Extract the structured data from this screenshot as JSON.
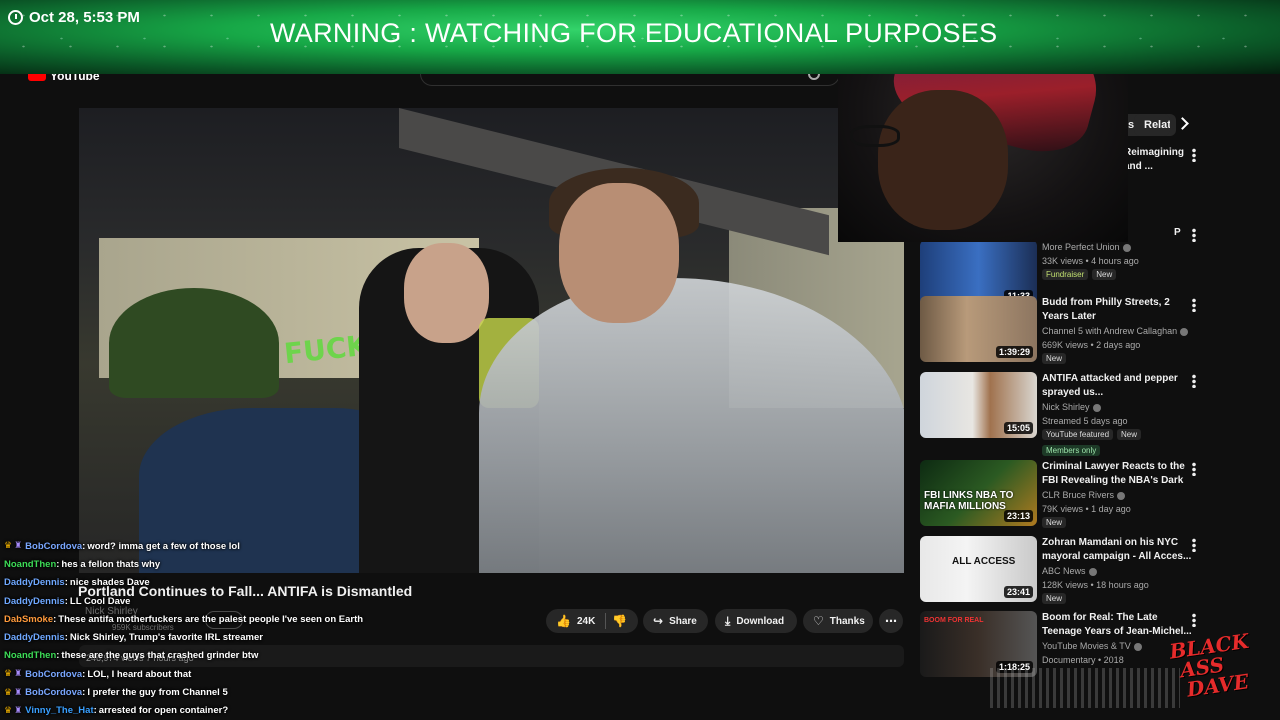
{
  "overlay": {
    "clock": "Oct 28, 5:53 PM",
    "warning": "WARNING : WATCHING FOR EDUCATIONAL PURPOSES",
    "logo_line1": "BLACK",
    "logo_line2": "ASS",
    "logo_line3": "DAVE"
  },
  "header": {
    "logo_text": "YouTube"
  },
  "chips": {
    "politics": "Politics News",
    "related": "Related"
  },
  "sidebar": {
    "items": [
      {
        "title": "Reimagining and ...",
        "channel": "",
        "views": "",
        "duration": "",
        "badges": []
      },
      {
        "title": "P",
        "channel": "More Perfect Union",
        "views": "33K views • 4 hours ago",
        "duration": "11:33",
        "badges": [
          "Fundraiser",
          "New"
        ]
      },
      {
        "title": "Budd from Philly Streets, 2 Years Later",
        "channel": "Channel 5 with Andrew Callaghan",
        "views": "669K views • 2 days ago",
        "duration": "1:39:29",
        "badges": [
          "New"
        ]
      },
      {
        "title": "ANTIFA attacked and pepper sprayed us...",
        "channel": "Nick Shirley",
        "views": "Streamed 5 days ago",
        "duration": "15:05",
        "badges": [
          "YouTube featured",
          "New"
        ],
        "members": "Members only"
      },
      {
        "title": "Criminal Lawyer Reacts to the FBI Revealing the NBA's Dark ...",
        "channel": "CLR Bruce Rivers",
        "views": "79K views • 1 day ago",
        "duration": "23:13",
        "badges": [
          "New"
        ],
        "thumb_text": "FBI LINKS NBA TO MAFIA MILLIONS"
      },
      {
        "title": "Zohran Mamdani on his NYC mayoral campaign - All Acces...",
        "channel": "ABC News",
        "views": "128K views • 18 hours ago",
        "duration": "23:41",
        "badges": [
          "New"
        ],
        "thumb_text": "ALL ACCESS"
      },
      {
        "title": "Boom for Real: The Late Teenage Years of Jean-Michel...",
        "channel": "YouTube Movies & TV",
        "views": "Documentary • 2018",
        "duration": "1:18:25",
        "badges": [],
        "thumb_text": "BOOM FOR REAL"
      }
    ]
  },
  "video": {
    "title": "Portland Continues to Fall... ANTIFA is Dismantled",
    "graffiti": "FUCK",
    "channel": "Nick Shirley",
    "subscribers": "959K subscribers",
    "views_line": "246,974 views  7 hours ago",
    "like_count": "24K",
    "share_label": "Share",
    "download_label": "Download",
    "thanks_label": "Thanks"
  },
  "chat": [
    {
      "user": "BobCordova",
      "color": "#7aa7ff",
      "crown": true,
      "gift": true,
      "text": "word? imma get a few of those lol"
    },
    {
      "user": "NoandThen",
      "color": "#3ddc57",
      "crown": false,
      "gift": false,
      "text": "hes a fellon thats why"
    },
    {
      "user": "DaddyDennis",
      "color": "#6fa8ff",
      "crown": false,
      "gift": false,
      "text": "nice shades Dave"
    },
    {
      "user": "DaddyDennis",
      "color": "#6fa8ff",
      "crown": false,
      "gift": false,
      "text": "LL Cool Dave"
    },
    {
      "user": "DabSmoke",
      "color": "#ff9a3c",
      "crown": false,
      "gift": false,
      "text": "These antifa motherfuckers are the palest people I've seen on Earth"
    },
    {
      "user": "DaddyDennis",
      "color": "#6fa8ff",
      "crown": false,
      "gift": false,
      "text": "Nick Shirley, Trump's favorite IRL streamer"
    },
    {
      "user": "NoandThen",
      "color": "#3ddc57",
      "crown": false,
      "gift": false,
      "text": "these are the guys that crashed grinder btw"
    },
    {
      "user": "BobCordova",
      "color": "#7aa7ff",
      "crown": true,
      "gift": true,
      "text": "LOL, I heard about that"
    },
    {
      "user": "BobCordova",
      "color": "#7aa7ff",
      "crown": true,
      "gift": true,
      "text": "I prefer the guy from Channel 5"
    },
    {
      "user": "Vinny_The_Hat",
      "color": "#3aa0ff",
      "crown": true,
      "gift": true,
      "text": "arrested for open container?"
    }
  ],
  "colors": {
    "accent_red": "#ff0000",
    "banner_green": "#17a847",
    "logo_red": "#e62b2b"
  }
}
